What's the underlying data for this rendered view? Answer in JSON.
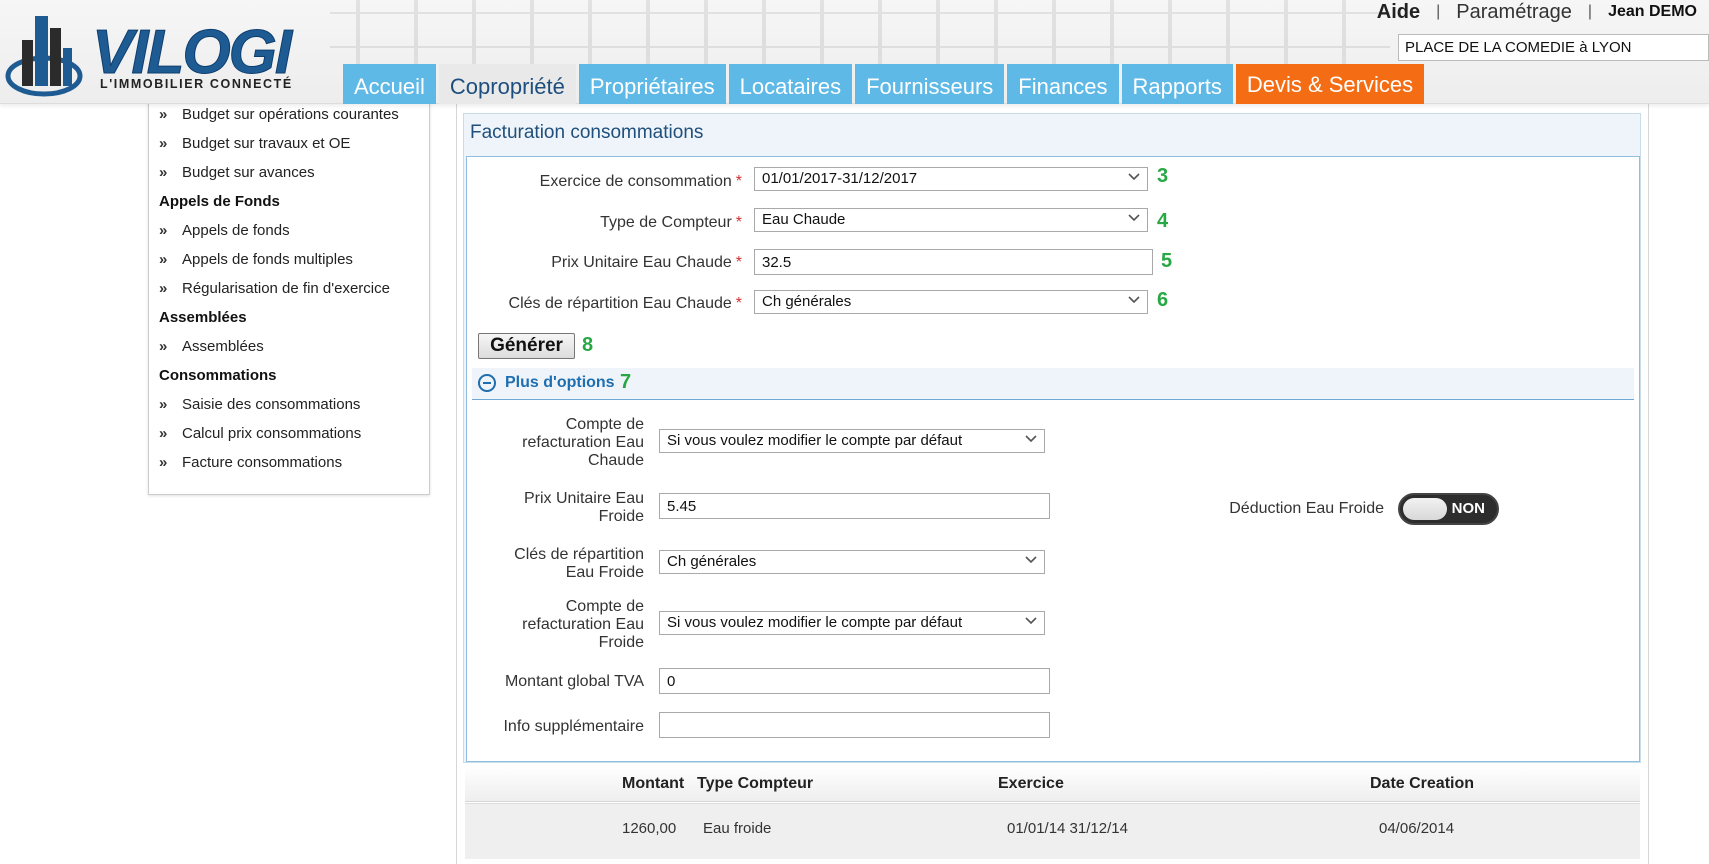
{
  "header": {
    "logo_text": "VILOGI",
    "logo_tagline": "L'IMMOBILIER CONNECTÉ",
    "help": "Aide",
    "separator": "|",
    "settings": "Paramétrage",
    "user": "Jean DEMO",
    "property": "PLACE DE LA COMEDIE à LYON"
  },
  "nav": {
    "tabs": [
      {
        "label": "Accueil"
      },
      {
        "label": "Copropriété"
      },
      {
        "label": "Propriétaires"
      },
      {
        "label": "Locataires"
      },
      {
        "label": "Fournisseurs"
      },
      {
        "label": "Finances"
      },
      {
        "label": "Rapports"
      },
      {
        "label": "Devis & Services"
      }
    ],
    "active_tab": "Copropriété",
    "colors": {
      "tab": "#5fb9e6",
      "active": "#e9e9e9",
      "highlight": "#f46d14"
    }
  },
  "sidebar": {
    "items": [
      {
        "label": "Budget sur opérations courantes",
        "kind": "link"
      },
      {
        "label": "Budget sur travaux et OE",
        "kind": "link"
      },
      {
        "label": "Budget sur avances",
        "kind": "link"
      },
      {
        "label": "Appels de Fonds",
        "kind": "heading"
      },
      {
        "label": "Appels de fonds",
        "kind": "link"
      },
      {
        "label": "Appels de fonds multiples",
        "kind": "link"
      },
      {
        "label": "Régularisation de fin d'exercice",
        "kind": "link"
      },
      {
        "label": "Assemblées",
        "kind": "heading"
      },
      {
        "label": "Assemblées",
        "kind": "link"
      },
      {
        "label": "Consommations",
        "kind": "heading"
      },
      {
        "label": "Saisie des consommations",
        "kind": "link"
      },
      {
        "label": "Calcul prix consommations",
        "kind": "link"
      },
      {
        "label": "Facture consommations",
        "kind": "link"
      }
    ]
  },
  "main": {
    "title": "Facturation consommations",
    "required_marker": "*",
    "form": {
      "exercice": {
        "label": "Exercice de consommation",
        "value": "01/01/2017-31/12/2017",
        "marker": "3"
      },
      "type_compteur": {
        "label": "Type de Compteur",
        "value": "Eau Chaude",
        "marker": "4"
      },
      "prix_unitaire": {
        "label": "Prix Unitaire Eau Chaude",
        "value": "32.5",
        "marker": "5"
      },
      "cles": {
        "label": "Clés de répartition Eau Chaude",
        "value": "Ch générales",
        "marker": "6"
      }
    },
    "generate": {
      "label": "Générer",
      "marker": "8"
    },
    "options": {
      "label": "Plus d'options",
      "marker": "7",
      "compte_ec": {
        "label": "Compte de refacturation Eau Chaude",
        "value": "Si vous voulez modifier le compte par défaut"
      },
      "prix_ef": {
        "label": "Prix Unitaire Eau Froide",
        "value": "5.45"
      },
      "cles_ef": {
        "label": "Clés de répartition Eau Froide",
        "value": "Ch générales"
      },
      "compte_ef": {
        "label": "Compte de refacturation Eau Froide",
        "value": "Si vous voulez modifier le compte par défaut"
      },
      "tva": {
        "label": "Montant global TVA",
        "value": "0"
      },
      "info": {
        "label": "Info supplémentaire",
        "value": ""
      },
      "deduction": {
        "label": "Déduction Eau Froide",
        "state": "NON"
      }
    },
    "table": {
      "columns": [
        "Montant",
        "Type Compteur",
        "Exercice",
        "Date Creation"
      ],
      "rows": [
        {
          "montant": "1260,00",
          "type": "Eau froide",
          "exercice": "01/01/14 31/12/14",
          "date": "04/06/2014"
        }
      ]
    }
  }
}
